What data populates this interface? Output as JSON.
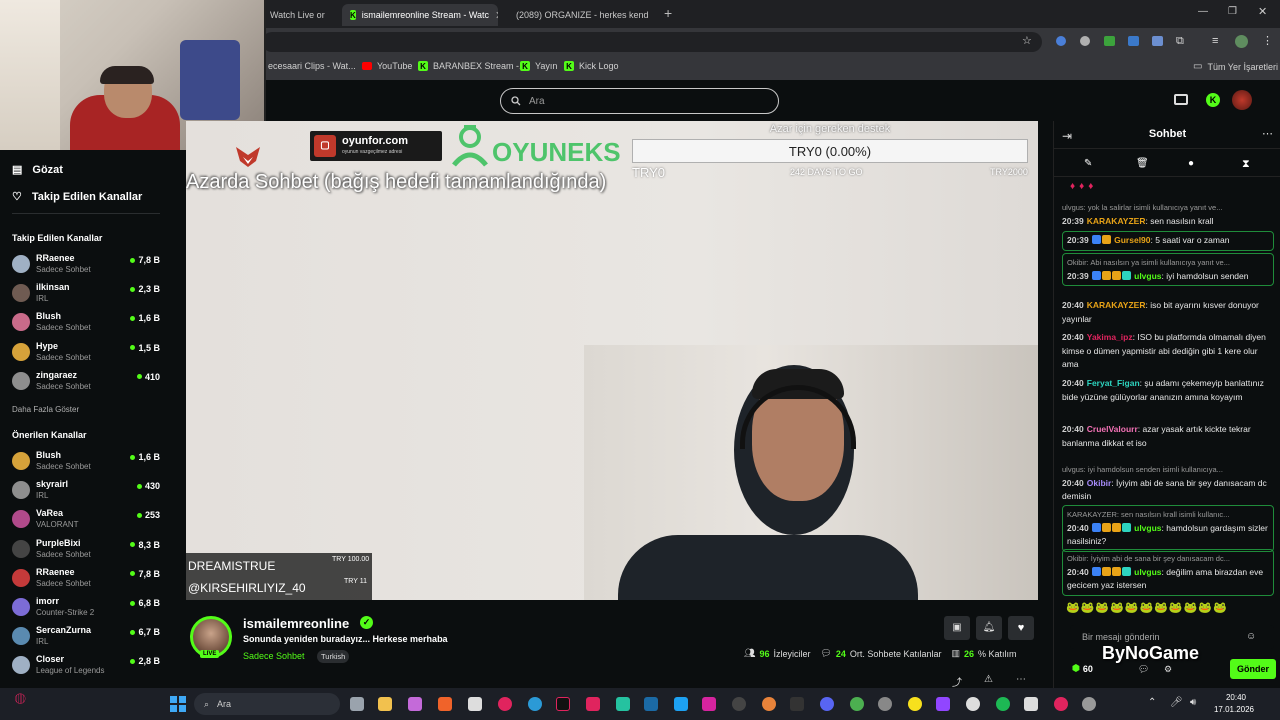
{
  "browser": {
    "tabs": [
      {
        "label": "Watch Live or",
        "active": false
      },
      {
        "label": "ismailemreonline Stream - Watc",
        "active": true
      },
      {
        "label": "(2089) ORGANIZE - herkes kend",
        "active": false
      }
    ],
    "bookmarks": [
      "ecesaari Clips - Wat...",
      "YouTube",
      "BARANBEX Stream -...",
      "Yayın",
      "Kick Logo"
    ],
    "all_bookmarks": "Tüm Yer İşaretleri"
  },
  "search": {
    "placeholder": "Ara"
  },
  "sidebar": {
    "nav": [
      {
        "label": "Gözat",
        "icon": "browse-icon"
      },
      {
        "label": "Takip Edilen Kanallar",
        "icon": "heart-icon"
      }
    ],
    "followed_heading": "Takip Edilen Kanallar",
    "followed": [
      {
        "name": "RRaenee",
        "category": "Sadece Sohbet",
        "viewers": "7,8 B"
      },
      {
        "name": "ilkinsan",
        "category": "IRL",
        "viewers": "2,3 B"
      },
      {
        "name": "Blush",
        "category": "Sadece Sohbet",
        "viewers": "1,6 B"
      },
      {
        "name": "Hype",
        "category": "Sadece Sohbet",
        "viewers": "1,5 B"
      },
      {
        "name": "zingaraez",
        "category": "Sadece Sohbet",
        "viewers": "410"
      }
    ],
    "show_more": "Daha Fazla Göster",
    "recommended_heading": "Önerilen Kanallar",
    "recommended": [
      {
        "name": "Blush",
        "category": "Sadece Sohbet",
        "viewers": "1,6 B"
      },
      {
        "name": "skyrairl",
        "category": "IRL",
        "viewers": "430"
      },
      {
        "name": "VaRea",
        "category": "VALORANT",
        "viewers": "253"
      },
      {
        "name": "PurpleBixi",
        "category": "Sadece Sohbet",
        "viewers": "8,3 B"
      },
      {
        "name": "RRaenee",
        "category": "Sadece Sohbet",
        "viewers": "7,8 B"
      },
      {
        "name": "imorr",
        "category": "Counter-Strike 2",
        "viewers": "6,8 B"
      },
      {
        "name": "SercanZurna",
        "category": "IRL",
        "viewers": "6,7 B"
      },
      {
        "name": "Closer",
        "category": "League of Legends",
        "viewers": "2,8 B"
      }
    ]
  },
  "player": {
    "sponsor1": "oyunfor.com",
    "sponsor1_sub": "oyunun vazgeçilmez adresi",
    "sponsor2": "OYUNEKS",
    "goal_title": "Azar için gereken destek",
    "goal_value": "TRY0 (0.00%)",
    "goal_progress": 0,
    "goal_start": "TRY0",
    "goal_days": "242 DAYS TO GO",
    "goal_end": "TRY2000",
    "overlay_text": "Azarda Sohbet (bağış hedefi tamamlandığında)",
    "donor1": "DREAMISTRUE",
    "donor1_amount": "TRY 100.00",
    "donor2": "@KIRSEHIRLIYIZ_40",
    "donor2_amount": "TRY 11"
  },
  "stream": {
    "channel": "ismailemreonline",
    "title": "Sonunda yeniden buradayız... Herkese merhaba",
    "category": "Sadece Sohbet",
    "tag": "Turkish",
    "live": "LIVE",
    "viewers": "96",
    "viewers_label": "İzleyiciler",
    "avg_chatters": "24",
    "avg_chatters_label": "Ort. Sohbete Katılanlar",
    "participation": "26",
    "participation_label": "% Katılım"
  },
  "chat": {
    "title": "Sohbet",
    "messages": [
      {
        "reply": "ulvgus: yok la salirlar isimli kullanıcıya yanıt ve...",
        "time": "20:39",
        "user": "KARAKAYZER",
        "color": "#e8a317",
        "text": "sen nasılsın krall",
        "highlight": false
      },
      {
        "reply": "",
        "time": "20:39",
        "user": "Gursel90",
        "color": "#e8a317",
        "text": "5 saati var o zaman",
        "highlight": true
      },
      {
        "reply": "Okibir: Abi nasılsın ya isimli kullanıcıya yanıt ve...",
        "time": "20:39",
        "user": "ulvgus",
        "color": "#53fc18",
        "text": "iyi hamdolsun senden",
        "highlight": true
      },
      {
        "reply": "",
        "time": "20:40",
        "user": "KARAKAYZER",
        "color": "#e8a317",
        "text": "iso bit ayarını kısver donuyor yayınlar",
        "highlight": false
      },
      {
        "reply": "",
        "time": "20:40",
        "user": "Yakima_ipz",
        "color": "#e0245e",
        "text": "ISO bu platformda olmamalı diyen kimse o dümen yapmistir abi dediğin gibi 1 kere olur ama",
        "highlight": false
      },
      {
        "reply": "",
        "time": "20:40",
        "user": "Feryat_Figan",
        "color": "#2dd4bf",
        "text": "şu adamı çekemeyip banlattınız bide yüzüne gülüyorlar ananızın amına koyayım",
        "highlight": false
      },
      {
        "reply": "",
        "time": "20:40",
        "user": "CruelValourr",
        "color": "#f472b6",
        "text": "azar yasak artık kickte tekrar banlanma dikkat et iso",
        "highlight": false
      },
      {
        "reply": "ulvgus: iyi hamdolsun senden isimli kullanıcıya...",
        "time": "20:40",
        "user": "Okibir",
        "color": "#a78bfa",
        "text": "İyiyim abi de sana bir şey danısacam dc demisin",
        "highlight": false
      },
      {
        "reply": "KARAKAYZER: sen nasılsın krall isimli kullanıc...",
        "time": "20:40",
        "user": "ulvgus",
        "color": "#53fc18",
        "text": "hamdolsun gardaşım sizler nasilsiniz?",
        "highlight": true
      },
      {
        "reply": "Okibir: İyiyim abi de sana bir şey danısacam dc...",
        "time": "20:40",
        "user": "ulvgus",
        "color": "#53fc18",
        "text": "değilim ama birazdan eve gecicem yaz istersen",
        "highlight": true
      }
    ],
    "input_placeholder": "Bir mesajı gönderin",
    "points": "60",
    "send_label": "Gönder",
    "watermark": "ByNoGame"
  },
  "taskbar": {
    "search": "Ara",
    "time": "20:40",
    "date": "17.01.2026"
  }
}
